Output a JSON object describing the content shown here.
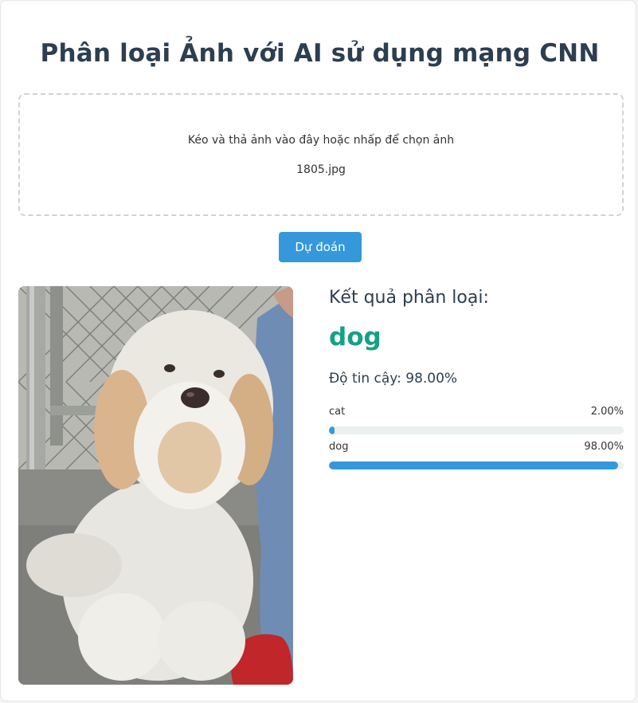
{
  "title": "Phân loại Ảnh với AI sử dụng mạng CNN",
  "upload": {
    "hint": "Kéo và thả ảnh vào đây hoặc nhấp để chọn ảnh",
    "filename": "1805.jpg"
  },
  "predict_button": "Dự đoán",
  "result": {
    "heading": "Kết quả phân loại:",
    "label": "dog",
    "confidence_text": "Độ tin cậy: 98.00%",
    "probabilities": [
      {
        "name": "cat",
        "percent_text": "2.00%",
        "value": 0.02
      },
      {
        "name": "dog",
        "percent_text": "98.00%",
        "value": 0.98
      }
    ]
  },
  "colors": {
    "accent": "#3498db",
    "label": "#16a085",
    "title": "#2c3e50"
  },
  "image": {
    "subject": "dog-photo"
  }
}
